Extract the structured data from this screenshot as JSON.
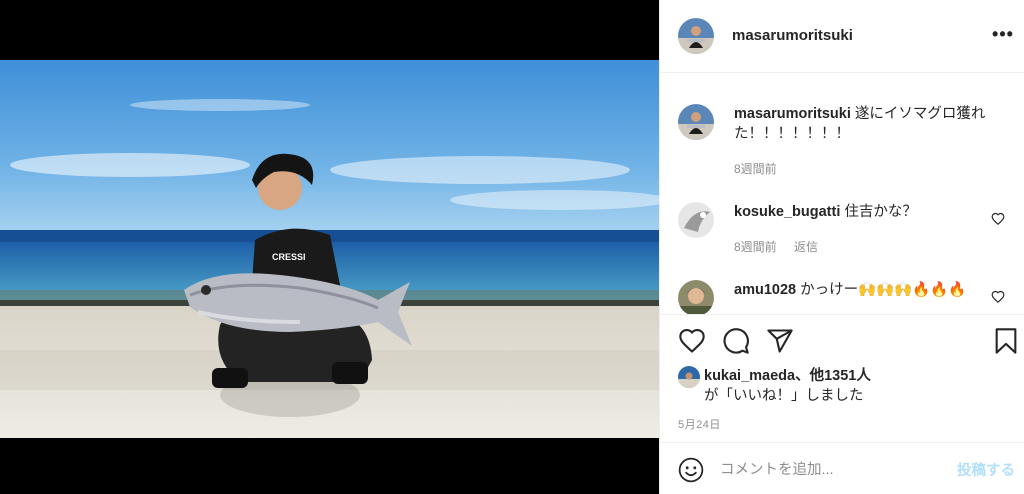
{
  "post": {
    "username": "masarumoritsuki",
    "more_label": "•••"
  },
  "comments": [
    {
      "username": "masarumoritsuki",
      "text": "遂にイソマグロ獲れた！！！！！！！",
      "time": "8週間前",
      "reply": ""
    },
    {
      "username": "kosuke_bugatti",
      "text": "住吉かな？",
      "time": "8週間前",
      "reply": "返信"
    },
    {
      "username": "amu1028",
      "text": "かっけー🙌🙌🙌🔥🔥🔥",
      "time": "",
      "reply": ""
    }
  ],
  "likes": {
    "line1_user": "kukai_maeda",
    "line1_rest": "、他1351人",
    "line2": "が「いいね！」しました"
  },
  "date": "5月24日",
  "add_comment": {
    "placeholder": "コメントを追加...",
    "post_label": "投稿する"
  },
  "icons": {
    "like": "heart-icon",
    "comment": "comment-icon",
    "share": "share-icon",
    "save": "bookmark-icon",
    "emoji": "emoji-icon",
    "options": "more-icon"
  },
  "colors": {
    "post_button": "#b2dffc",
    "meta": "#8e8e8e",
    "text": "#262626"
  }
}
